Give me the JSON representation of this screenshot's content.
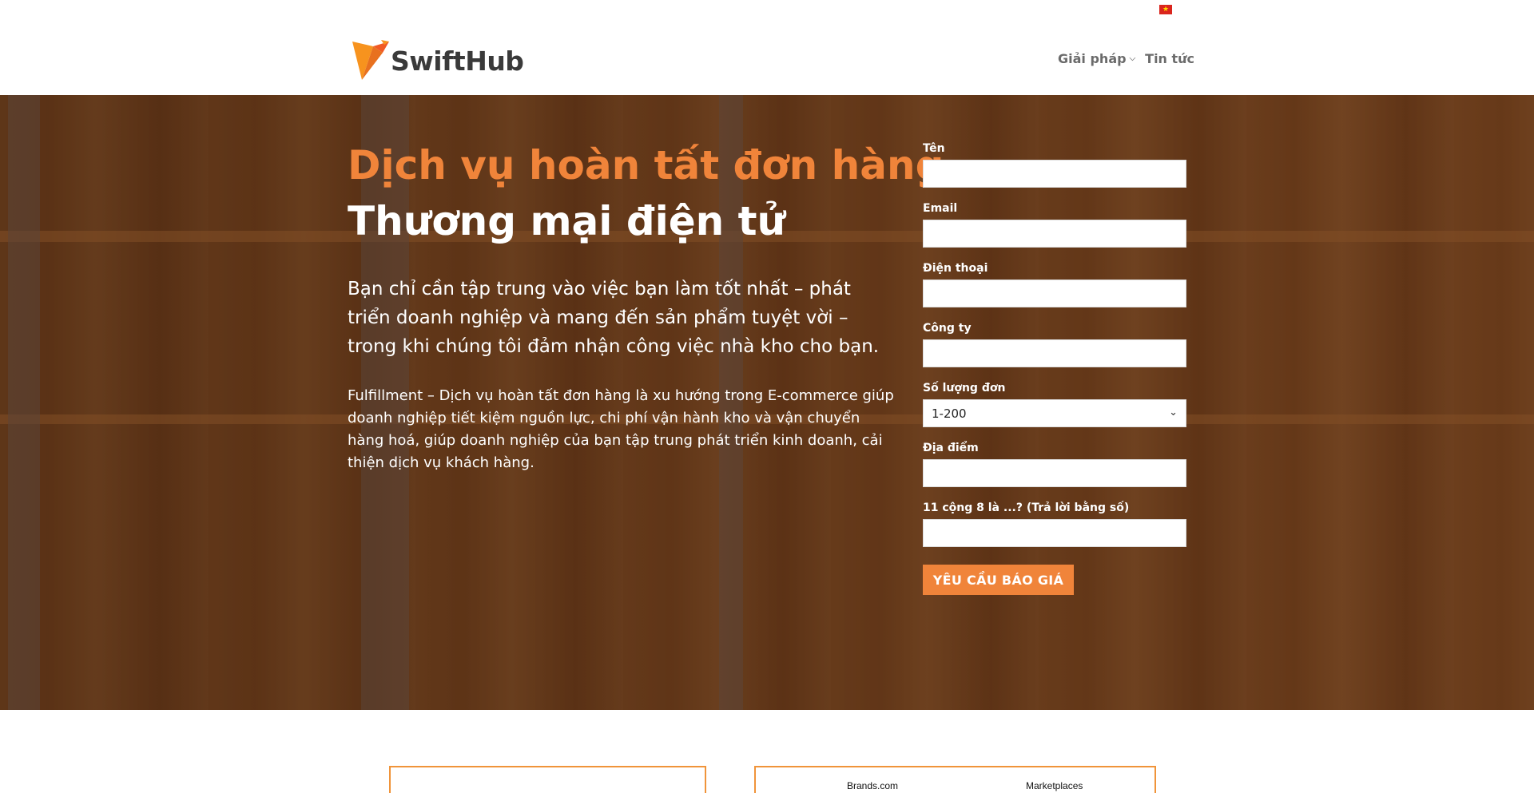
{
  "header": {
    "flag_icon": "vietnam-flag-icon",
    "logo_icon": "swifthub-bird-logo-icon",
    "brand": "SwiftHub",
    "nav": [
      {
        "label": "Giải pháp",
        "icon": "chevron-down-icon"
      },
      {
        "label": "Tin tức"
      }
    ]
  },
  "hero": {
    "title_line1": "Dịch vụ hoàn tất đơn hàng",
    "title_line2": "Thương mại điện tử",
    "lead": "Bạn chỉ cần tập trung vào việc bạn làm tốt nhất – phát triển doanh nghiệp và mang đến sản phẩm tuyệt vời – trong khi chúng tôi đảm nhận công việc nhà kho cho bạn.",
    "body": "Fulfillment – Dịch vụ hoàn tất đơn hàng là xu hướng trong E-commerce giúp doanh nghiệp tiết kiệm nguồn lực, chi phí vận hành kho và vận chuyển hàng hoá, giúp doanh nghiệp của bạn tập trung phát triển kinh doanh, cải thiện dịch vụ khách hàng."
  },
  "form": {
    "name_label": "Tên",
    "email_label": "Email",
    "phone_label": "Điện thoại",
    "company_label": "Công ty",
    "orders_label": "Số lượng đơn",
    "orders_value": "1-200",
    "location_label": "Địa điểm",
    "captcha_label": "11 cộng 8 là ...? (Trả lời bằng số)",
    "submit_label": "YÊU CẦU BÁO GIÁ"
  },
  "bottom": {
    "tabs": [
      "Brands.com",
      "Marketplaces"
    ]
  },
  "colors": {
    "accent": "#f0843a",
    "text_dark": "#3a3a3a",
    "nav_text": "#6b6b6b"
  }
}
